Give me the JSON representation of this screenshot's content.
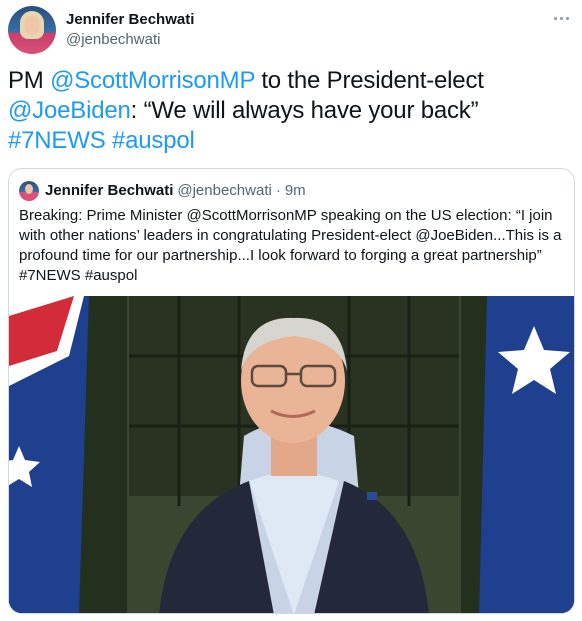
{
  "tweet": {
    "author_name": "Jennifer Bechwati",
    "author_handle": "@jenbechwati",
    "body": {
      "prefix": "PM ",
      "mention_1": "@ScottMorrisonMP",
      "middle": " to the President-elect ",
      "mention_2": "@JoeBiden",
      "quote_text": ": “We will always have your back” ",
      "hashtag_1": "#7NEWS",
      "hashtag_2": "#auspol"
    }
  },
  "quoted_tweet": {
    "author_name": "Jennifer Bechwati",
    "author_handle": "@jenbechwati",
    "separator": "·",
    "time_ago": "9m",
    "text": "Breaking: Prime Minister @ScottMorrisonMP speaking on the US election: “I join with other nations’ leaders in congratulating President-elect @JoeBiden...This is a profound time for our partnership...I look forward to forging a great partnership” #7NEWS #auspol"
  },
  "colors": {
    "link": "#1d9bf0",
    "text": "#0f1419",
    "secondary_text": "#536471",
    "border": "#cfd9de"
  },
  "icons": [
    "more-options-icon"
  ]
}
